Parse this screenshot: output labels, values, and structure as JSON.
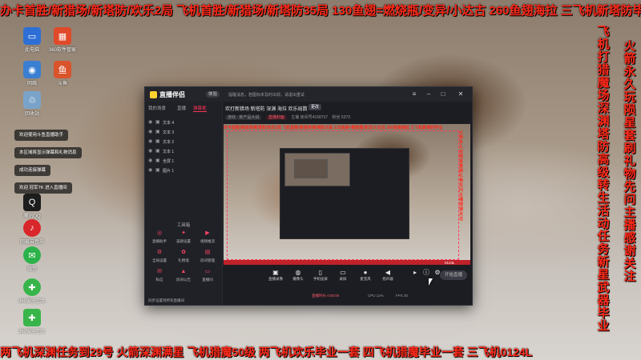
{
  "overlay": {
    "top_ticker": "办卡首胜/新猎场/新塔防/欢乐2局 飞机首胜/新猎场/新塔防35局 130鱼翅=燃烧瓶/变异/小达古 260鱼翅海拉 三飞机新塔防毕业",
    "bottom_ticker": "两飞机深渊任务到29号 火箭深渊满星 飞机猎魔50级 两飞机欢乐毕业一套 四飞机猎魔毕业一套 三飞机0124L",
    "vertical_left": "飞机打猎魔场深渊塔防高级转生活动任务新星武器毕业",
    "vertical_right": "火箭永久玩陨星套刷礼物先问主播感谢关注",
    "color": "#ff2a1a"
  },
  "desktop_icons": [
    {
      "label": "此电脑",
      "icon": "computer-icon"
    },
    {
      "label": "360软件管家",
      "icon": "app-icon"
    },
    {
      "label": "网络",
      "icon": "network-icon"
    },
    {
      "label": "斗鱼",
      "icon": "douyu-icon"
    },
    {
      "label": "回收站",
      "icon": "recycle-bin-icon"
    },
    {
      "label": "腾讯QQ",
      "icon": "qq-icon"
    },
    {
      "label": "网易云音乐",
      "icon": "music-icon"
    },
    {
      "label": "微信",
      "icon": "wechat-icon"
    },
    {
      "label": "360安全卫士",
      "icon": "security-icon"
    },
    {
      "label": "360安全卫士",
      "icon": "security-icon"
    }
  ],
  "notifications": [
    "欢迎使用斗鱼直播助手",
    "本区域将显示弹幕和礼物消息",
    "成功连接弹幕",
    "欢迎 冠军TK 进入直播间"
  ],
  "app": {
    "name": "直播伴侣",
    "version": "体验",
    "title_notice": "提醒消息，若图标未及时出现，请退出重试",
    "left_tabs": [
      "我的场景",
      "直播",
      "弹幕框"
    ],
    "sources": [
      "文本 4",
      "文本 3",
      "文本 2",
      "文本 1",
      "全屏 1",
      "图片 1"
    ],
    "tools_title": "工具箱",
    "tools": [
      {
        "label": "直播助手",
        "icon": "broadcast-icon"
      },
      {
        "label": "美颜设置",
        "icon": "beauty-icon"
      },
      {
        "label": "视频推流",
        "icon": "stream-icon"
      },
      {
        "label": "全局设置",
        "icon": "settings-icon"
      },
      {
        "label": "礼物墙",
        "icon": "gift-icon"
      },
      {
        "label": "房间管理",
        "icon": "room-icon"
      },
      {
        "label": "私信",
        "icon": "message-icon"
      },
      {
        "label": "房间公告",
        "icon": "notice-icon"
      },
      {
        "label": "直播间",
        "icon": "tv-icon"
      }
    ],
    "sync_text": "同步设置到所有直播间",
    "stage_title": "欢打新猎场 新塔防 深渊 海拉 欢乐局数",
    "stage_badge": "更改",
    "meta_category": "游戏 · 新产品大战",
    "meta_cover": "直播封面",
    "meta_room": "主播 房间号4158737",
    "meta_followers": "粉丝 5373",
    "controls": [
      {
        "label": "直播录像",
        "icon": "record-icon"
      },
      {
        "label": "摄像头",
        "icon": "camera-icon"
      },
      {
        "label": "手机投屏",
        "icon": "phone-icon"
      },
      {
        "label": "录屏",
        "icon": "screen-icon"
      },
      {
        "label": "麦克风",
        "icon": "mic-icon"
      },
      {
        "label": "扬声器",
        "icon": "speaker-icon"
      }
    ],
    "go_live": "开始直播",
    "status": {
      "live_time": "直播时长 0:00:00",
      "cpu": "CPU 12%",
      "fps": "FPS 30"
    }
  },
  "preview": {
    "ticker": "办卡首胜/新猎场/新塔防/欢乐2局 飞机首胜/新猎场/新塔防35局 130鱼翅=燃烧瓶/变异/小达古 260鱼翅海拉 三飞机新塔防毕业",
    "vertical": "火箭永久玩陨星套刷礼物先问主播感谢关注",
    "bottom_text": "0124L"
  }
}
